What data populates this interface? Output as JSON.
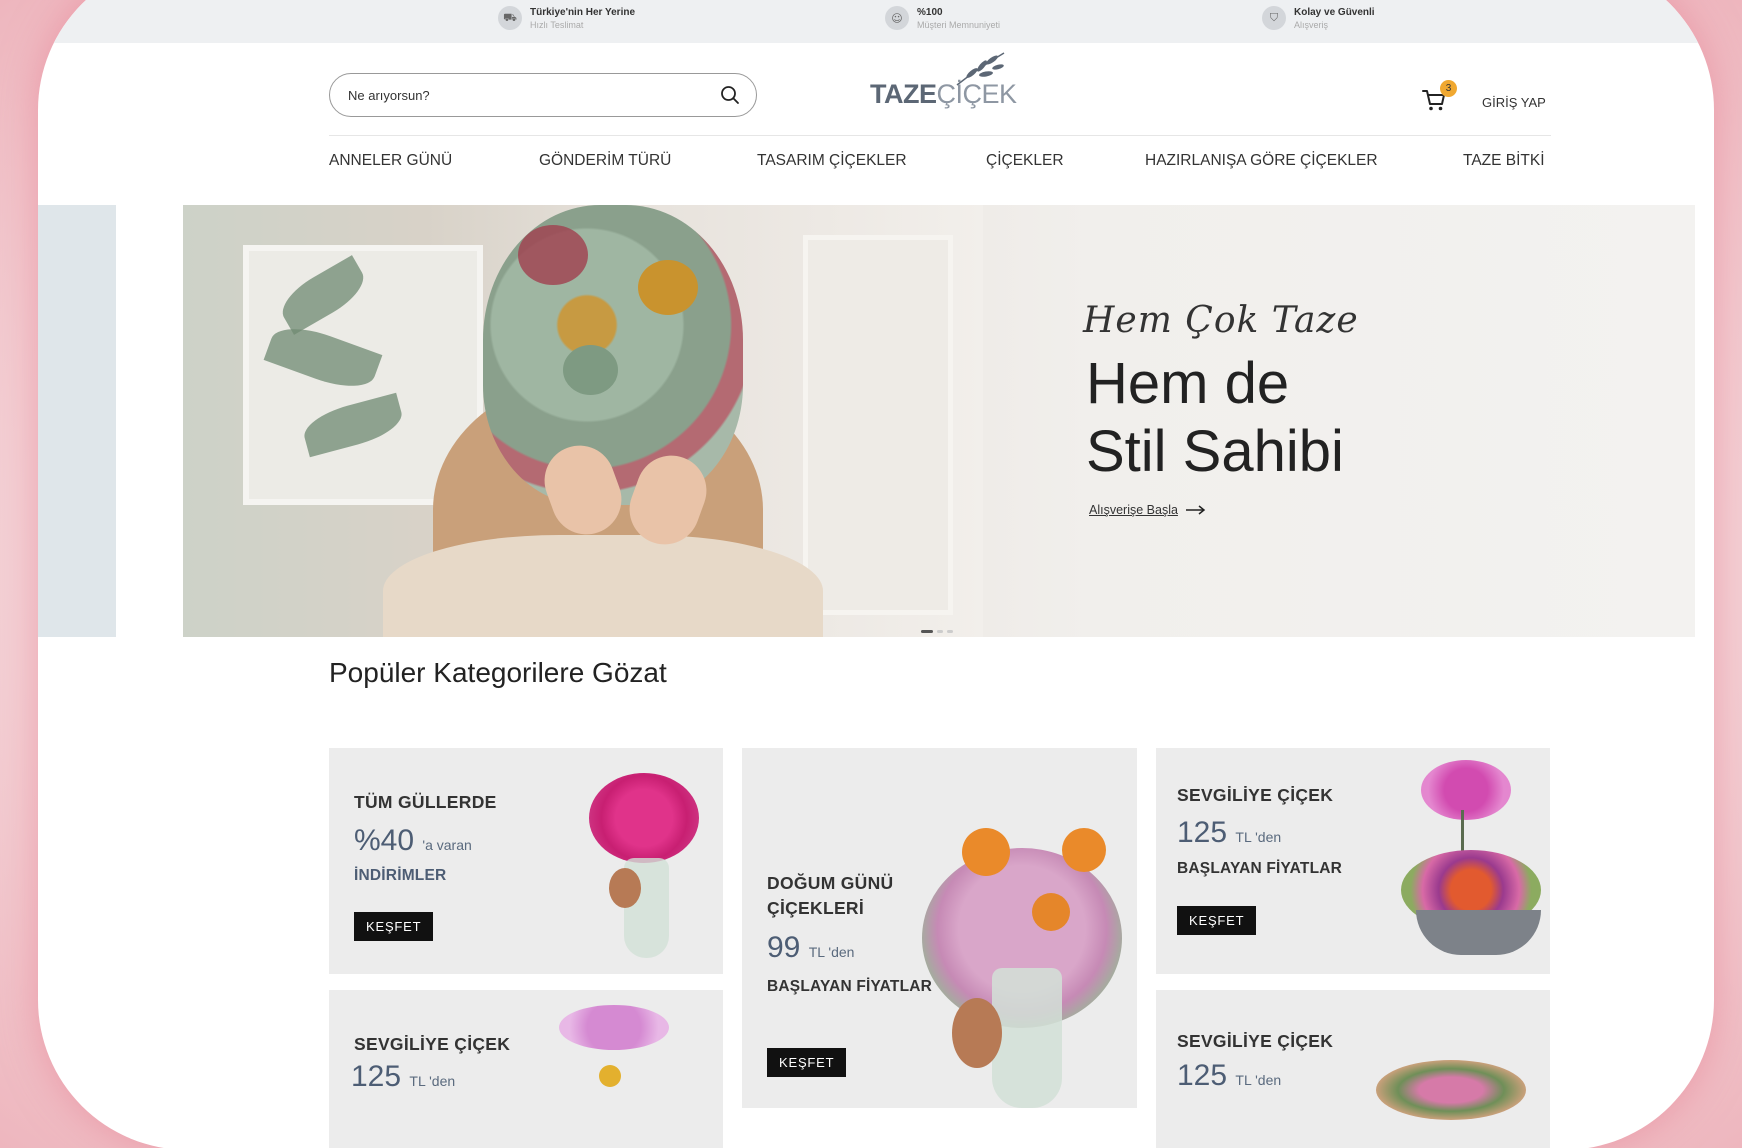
{
  "topbar": {
    "items": [
      {
        "title": "Türkiye'nin Her Yerine",
        "subtitle": "Hızlı Teslimat",
        "icon": "truck-icon"
      },
      {
        "title": "%100",
        "subtitle": "Müşteri Memnuniyeti",
        "icon": "smile-icon"
      },
      {
        "title": "Kolay ve Güvenli",
        "subtitle": "Alışveriş",
        "icon": "shield-icon"
      }
    ]
  },
  "header": {
    "search_placeholder": "Ne arıyorsun?",
    "logo_bold": "TAZE",
    "logo_light": "ÇİÇEK",
    "cart_count": "3",
    "login_label": "GİRİŞ YAP"
  },
  "nav": {
    "items": [
      "ANNELER GÜNÜ",
      "GÖNDERİM TÜRÜ",
      "TASARIM ÇİÇEKLER",
      "ÇİÇEKLER",
      "HAZIRLANIŞA GÖRE ÇİÇEKLER",
      "TAZE BİTKİ"
    ]
  },
  "hero": {
    "script": "Hem Çok Taze",
    "headline_line1": "Hem de",
    "headline_line2": "Stil Sahibi",
    "cta": "Alışverişe Başla"
  },
  "carousel": {
    "count": 3,
    "active": 1
  },
  "categories": {
    "title": "Popüler Kategorilere Gözat",
    "cards": [
      {
        "title": "TÜM GÜLLERDE",
        "number": "%40",
        "suffix": "'a varan",
        "subtitle": "İNDİRİMLER",
        "button": "KEŞFET"
      },
      {
        "title_line1": "DOĞUM GÜNÜ",
        "title_line2": "ÇİÇEKLERİ",
        "number": "99",
        "suffix": "TL 'den",
        "subtitle": "BAŞLAYAN FİYATLAR",
        "button": "KEŞFET"
      },
      {
        "title": "SEVGİLİYE ÇİÇEK",
        "number": "125",
        "suffix": "TL 'den",
        "subtitle": "BAŞLAYAN FİYATLAR",
        "button": "KEŞFET"
      },
      {
        "title": "SEVGİLİYE ÇİÇEK",
        "number": "125",
        "suffix": "TL 'den"
      },
      {
        "title": "SEVGİLİYE ÇİÇEK",
        "number": "125",
        "suffix": "TL 'den"
      }
    ]
  },
  "colors": {
    "accent_badge": "#f0a830",
    "button": "#111111",
    "price": "#4d5d74"
  }
}
